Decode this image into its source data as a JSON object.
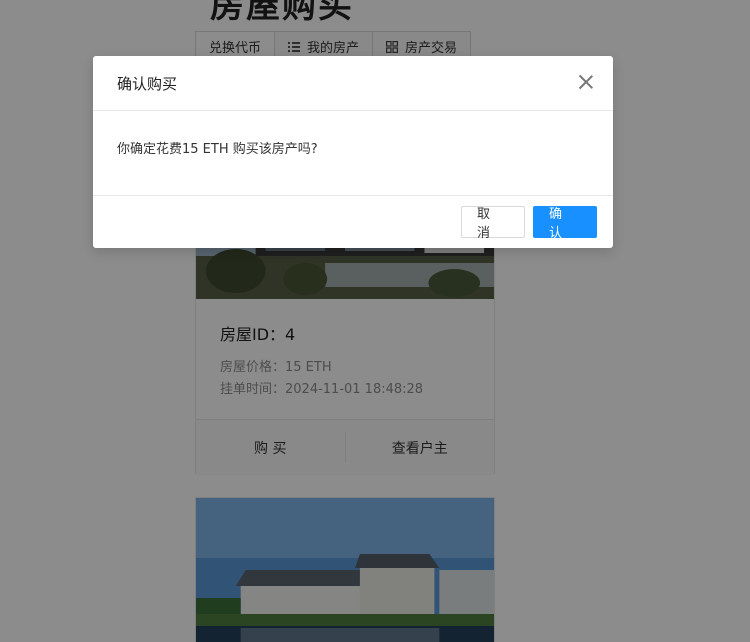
{
  "page": {
    "title": "房屋购买",
    "tabs": [
      {
        "label": "兑换代币",
        "icon": ""
      },
      {
        "label": "我的房产",
        "icon": "list-icon"
      },
      {
        "label": "房产交易",
        "icon": "grid-icon"
      }
    ]
  },
  "card": {
    "house_id_label": "房屋ID：4",
    "price_label": "房屋价格：15 ETH",
    "listed_time_label": "挂单时间：2024-11-01 18:48:28",
    "buy_label": "购 买",
    "view_owner_label": "查看户主"
  },
  "modal": {
    "title": "确认购买",
    "message": "你确定花费15 ETH 购买该房产吗?",
    "cancel_label": "取 消",
    "confirm_label": "确 认"
  },
  "colors": {
    "primary": "#1890ff",
    "overlay": "rgba(0,0,0,0.45)"
  }
}
